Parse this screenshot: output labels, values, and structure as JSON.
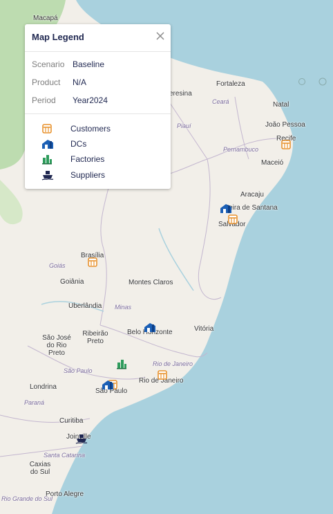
{
  "legend": {
    "title": "Map Legend",
    "rows": [
      {
        "key": "Scenario",
        "value": "Baseline"
      },
      {
        "key": "Product",
        "value": "N/A"
      },
      {
        "key": "Period",
        "value": "Year2024"
      }
    ],
    "items": [
      {
        "label": "Customers",
        "icon": "store-icon",
        "color": "#e8922e"
      },
      {
        "label": "DCs",
        "icon": "warehouse-icon",
        "color": "#1b5fb5"
      },
      {
        "label": "Factories",
        "icon": "factory-icon",
        "color": "#2e9c5c"
      },
      {
        "label": "Suppliers",
        "icon": "ship-icon",
        "color": "#1f2750"
      }
    ]
  },
  "map": {
    "cities": [
      "Macapá",
      "Fortaleza",
      "Natal",
      "João Pessoa",
      "Recife",
      "Maceió",
      "Aracaju",
      "Feira de Santana",
      "Salvador",
      "Brasília",
      "Goiânia",
      "Montes Claros",
      "Uberlândia",
      "São José do Rio Preto",
      "Ribeirão Preto",
      "Belo Horizonte",
      "Vitória",
      "Rio de Janeiro",
      "São Paulo",
      "Londrina",
      "Curitiba",
      "Joinville",
      "Caxias do Sul",
      "Porto Alegre",
      "Teresina"
    ],
    "states": [
      "Ceará",
      "Piauí",
      "Pernambuco",
      "Goiás",
      "Minas",
      "São Paulo",
      "Rio de Janeiro",
      "Paraná",
      "Santa Catarina",
      "Rio Grande do Sul"
    ]
  }
}
